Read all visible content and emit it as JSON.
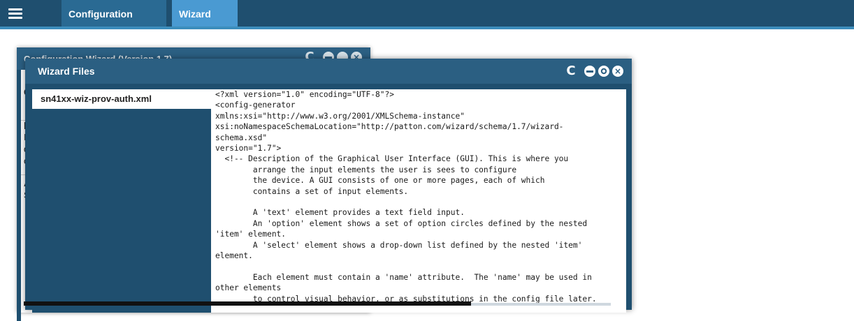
{
  "nav": {
    "tabs": [
      {
        "label": "Configuration Wizard"
      },
      {
        "label": "Wizard Files"
      }
    ]
  },
  "back_window": {
    "title": "Configuration Wizard (Version 1.7)",
    "fragments": [
      "C",
      "H",
      "Ir",
      "d",
      "c",
      "A",
      "S"
    ]
  },
  "front_window": {
    "title": "Wizard Files",
    "controls": {
      "refresh": "C",
      "close": "×"
    },
    "files": [
      {
        "name": "sn41xx-wiz-prov-auth.xml"
      }
    ],
    "code_lines": [
      "<?xml version=\"1.0\" encoding=\"UTF-8\"?>",
      "<config-generator",
      "xmlns:xsi=\"http://www.w3.org/2001/XMLSchema-instance\"",
      "xsi:noNamespaceSchemaLocation=\"http://patton.com/wizard/schema/1.7/wizard-",
      "schema.xsd\"",
      "version=\"1.7\">",
      "  <!-- Description of the Graphical User Interface (GUI). This is where you",
      "        arrange the input elements the user is sees to configure",
      "        the device. A GUI consists of one or more pages, each of which",
      "        contains a set of input elements.",
      "",
      "        A 'text' element provides a text field input.",
      "        An 'option' element shows a set of option circles defined by the nested",
      "'item' element.",
      "        A 'select' element shows a drop-down list defined by the nested 'item'",
      "element.",
      "",
      "        Each element must contain a 'name' attribute.  The 'name' may be used in",
      "other elements",
      "        to control visual behavior, or as substitutions in the config file later."
    ]
  }
}
